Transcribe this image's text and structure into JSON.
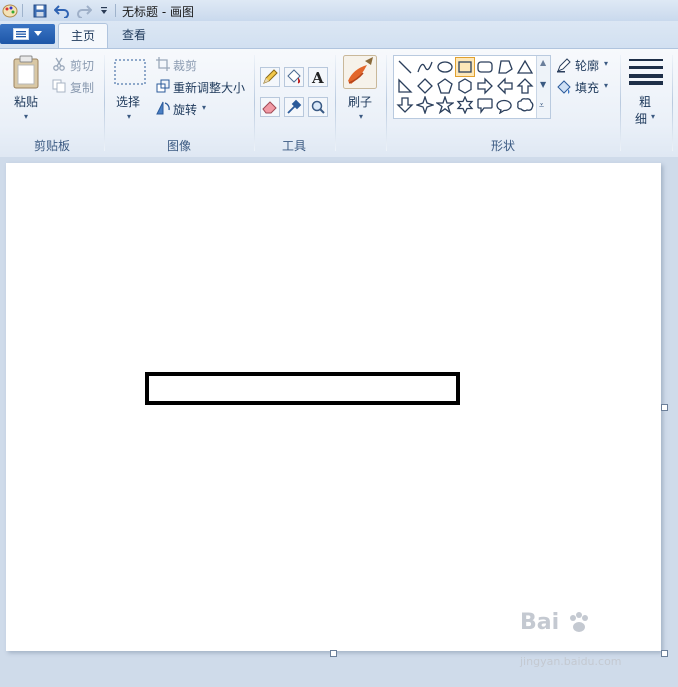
{
  "window": {
    "title": "无标题 - 画图"
  },
  "tabs": [
    {
      "label": "主页"
    },
    {
      "label": "查看"
    }
  ],
  "ribbon": {
    "clipboard": {
      "label": "剪贴板",
      "paste": "粘贴",
      "cut": "剪切",
      "copy": "复制"
    },
    "image": {
      "label": "图像",
      "select": "选择",
      "crop": "裁剪",
      "resize": "重新调整大小",
      "rotate": "旋转"
    },
    "tools": {
      "label": "工具"
    },
    "brushes": {
      "label": "刷子"
    },
    "shapes": {
      "label": "形状",
      "outline": "轮廓",
      "fill": "填充"
    },
    "size": {
      "label_line1": "粗",
      "label_line2": "细"
    }
  },
  "watermark": {
    "text": "Bai",
    "url": "jingyan.baidu.com"
  },
  "colors": {
    "accent": "#1d56a8",
    "ribbon_bg": "#eaf0f8",
    "selected_shape": "#f5b54a"
  }
}
